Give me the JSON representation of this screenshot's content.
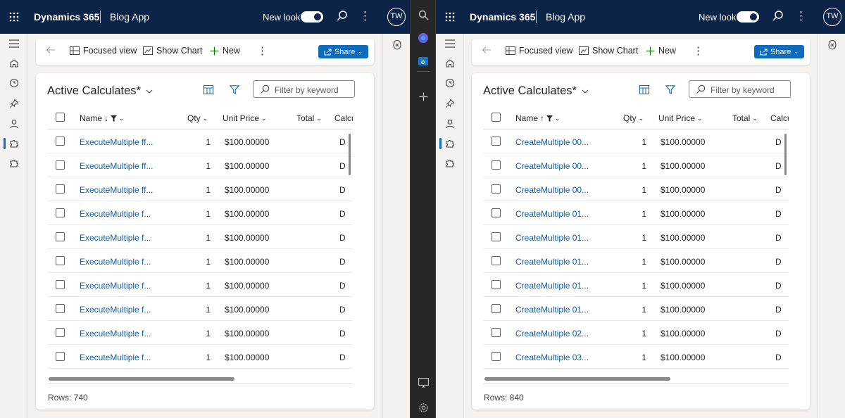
{
  "panes": [
    {
      "topbar": {
        "title": "Dynamics 365",
        "app_name": "Blog App",
        "new_look_label": "New look",
        "avatar_initials": "TW"
      },
      "commandbar": {
        "focused_view": "Focused view",
        "show_chart": "Show Chart",
        "new": "New",
        "share": "Share"
      },
      "view": {
        "title": "Active Calculates*",
        "search_placeholder": "Filter by keyword",
        "columns": {
          "name": "Name",
          "qty": "Qty",
          "unit_price": "Unit Price",
          "total": "Total",
          "calc": "Calcu"
        },
        "sort_direction": "descending",
        "rows": [
          {
            "name": "ExecuteMultiple ff...",
            "qty": "1",
            "unit_price": "$100.00000",
            "calc": "D"
          },
          {
            "name": "ExecuteMultiple ff...",
            "qty": "1",
            "unit_price": "$100.00000",
            "calc": "D"
          },
          {
            "name": "ExecuteMultiple ff...",
            "qty": "1",
            "unit_price": "$100.00000",
            "calc": "D"
          },
          {
            "name": "ExecuteMultiple f...",
            "qty": "1",
            "unit_price": "$100.00000",
            "calc": "D"
          },
          {
            "name": "ExecuteMultiple f...",
            "qty": "1",
            "unit_price": "$100.00000",
            "calc": "D"
          },
          {
            "name": "ExecuteMultiple f...",
            "qty": "1",
            "unit_price": "$100.00000",
            "calc": "D"
          },
          {
            "name": "ExecuteMultiple f...",
            "qty": "1",
            "unit_price": "$100.00000",
            "calc": "D"
          },
          {
            "name": "ExecuteMultiple f...",
            "qty": "1",
            "unit_price": "$100.00000",
            "calc": "D"
          },
          {
            "name": "ExecuteMultiple f...",
            "qty": "1",
            "unit_price": "$100.00000",
            "calc": "D"
          },
          {
            "name": "ExecuteMultiple f...",
            "qty": "1",
            "unit_price": "$100.00000",
            "calc": "D"
          }
        ],
        "rows_label": "Rows: 740"
      }
    },
    {
      "topbar": {
        "title": "Dynamics 365",
        "app_name": "Blog App",
        "new_look_label": "New look",
        "avatar_initials": "TW"
      },
      "commandbar": {
        "focused_view": "Focused view",
        "show_chart": "Show Chart",
        "new": "New",
        "share": "Share"
      },
      "view": {
        "title": "Active Calculates*",
        "search_placeholder": "Filter by keyword",
        "columns": {
          "name": "Name",
          "qty": "Qty",
          "unit_price": "Unit Price",
          "total": "Total",
          "calc": "Calcu"
        },
        "sort_direction": "ascending",
        "rows": [
          {
            "name": "CreateMultiple 00...",
            "qty": "1",
            "unit_price": "$100.00000",
            "calc": "D"
          },
          {
            "name": "CreateMultiple 00...",
            "qty": "1",
            "unit_price": "$100.00000",
            "calc": "D"
          },
          {
            "name": "CreateMultiple 00...",
            "qty": "1",
            "unit_price": "$100.00000",
            "calc": "D"
          },
          {
            "name": "CreateMultiple 01...",
            "qty": "1",
            "unit_price": "$100.00000",
            "calc": "D"
          },
          {
            "name": "CreateMultiple 01...",
            "qty": "1",
            "unit_price": "$100.00000",
            "calc": "D"
          },
          {
            "name": "CreateMultiple 01...",
            "qty": "1",
            "unit_price": "$100.00000",
            "calc": "D"
          },
          {
            "name": "CreateMultiple 01...",
            "qty": "1",
            "unit_price": "$100.00000",
            "calc": "D"
          },
          {
            "name": "CreateMultiple 01...",
            "qty": "1",
            "unit_price": "$100.00000",
            "calc": "D"
          },
          {
            "name": "CreateMultiple 02...",
            "qty": "1",
            "unit_price": "$100.00000",
            "calc": "D"
          },
          {
            "name": "CreateMultiple 03...",
            "qty": "1",
            "unit_price": "$100.00000",
            "calc": "D"
          }
        ],
        "rows_label": "Rows: 840"
      }
    }
  ],
  "colors": {
    "topbar": "#0b2447",
    "accent": "#0f6cbd",
    "link": "#115ea3"
  },
  "sidebar_icons": [
    "search-icon",
    "copilot-icon",
    "outlook-icon",
    "add-icon",
    "screenshot-icon",
    "settings-icon"
  ]
}
